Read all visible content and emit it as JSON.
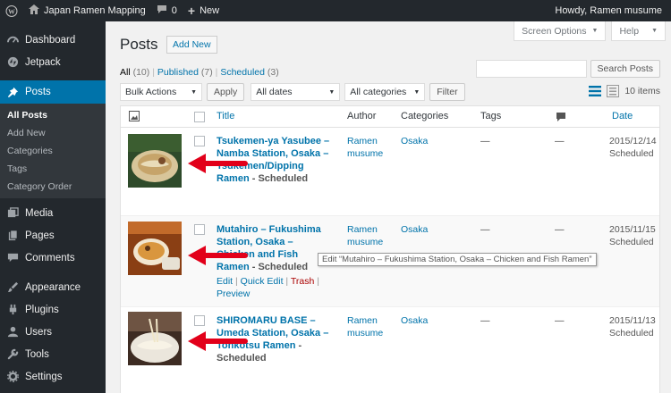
{
  "adminbar": {
    "site_name": "Japan Ramen Mapping",
    "comments_count": "0",
    "new_label": "New",
    "howdy": "Howdy, Ramen musume"
  },
  "sidebar": {
    "items": [
      {
        "label": "Dashboard",
        "icon": "dashboard-icon"
      },
      {
        "label": "Jetpack",
        "icon": "jetpack-icon"
      },
      {
        "label": "Posts",
        "icon": "pin-icon"
      },
      {
        "label": "Media",
        "icon": "media-icon"
      },
      {
        "label": "Pages",
        "icon": "pages-icon"
      },
      {
        "label": "Comments",
        "icon": "comments-icon"
      },
      {
        "label": "Appearance",
        "icon": "appearance-icon"
      },
      {
        "label": "Plugins",
        "icon": "plugins-icon"
      },
      {
        "label": "Users",
        "icon": "users-icon"
      },
      {
        "label": "Tools",
        "icon": "tools-icon"
      },
      {
        "label": "Settings",
        "icon": "settings-icon"
      }
    ],
    "posts_submenu": [
      "All Posts",
      "Add New",
      "Categories",
      "Tags",
      "Category Order"
    ]
  },
  "screen_options": "Screen Options",
  "help": "Help",
  "page_title": "Posts",
  "add_new": "Add New",
  "views": {
    "all": "All",
    "all_count": "(10)",
    "published": "Published",
    "published_count": "(7)",
    "scheduled": "Scheduled",
    "scheduled_count": "(3)"
  },
  "search_button": "Search Posts",
  "filters": {
    "bulk_actions": "Bulk Actions",
    "apply": "Apply",
    "all_dates": "All dates",
    "all_categories": "All categories",
    "filter": "Filter"
  },
  "items_count": "10 items",
  "columns": {
    "title": "Title",
    "author": "Author",
    "categories": "Categories",
    "tags": "Tags",
    "date": "Date"
  },
  "rows": [
    {
      "title": "Tsukemen-ya Yasubee – Namba Station, Osaka – Tsukemen/Dipping Ramen",
      "state": " - Scheduled",
      "author": "Ramen musume",
      "category": "Osaka",
      "tags": "—",
      "comments": "—",
      "date": "2015/12/14",
      "status": "Scheduled"
    },
    {
      "title": "Mutahiro – Fukushima Station, Osaka – Chicken and Fish Ramen",
      "state": " - Scheduled",
      "author": "Ramen musume",
      "category": "Osaka",
      "tags": "—",
      "comments": "—",
      "date": "2015/11/15",
      "status": "Scheduled",
      "actions": {
        "edit": "Edit",
        "quick_edit": "Quick Edit",
        "trash": "Trash",
        "preview": "Preview"
      }
    },
    {
      "title": "SHIROMARU BASE – Umeda Station, Osaka – Tonkotsu Ramen",
      "state": " - Scheduled",
      "author": "Ramen musume",
      "category": "Osaka",
      "tags": "—",
      "comments": "—",
      "date": "2015/11/13",
      "status": "Scheduled"
    }
  ],
  "tooltip": "Edit “Mutahiro – Fukushima Station, Osaka – Chicken and Fish Ramen”",
  "colors": {
    "admin_bar": "#23282d",
    "active_menu": "#0073aa",
    "link": "#0073aa",
    "arrow": "#e2001a"
  }
}
